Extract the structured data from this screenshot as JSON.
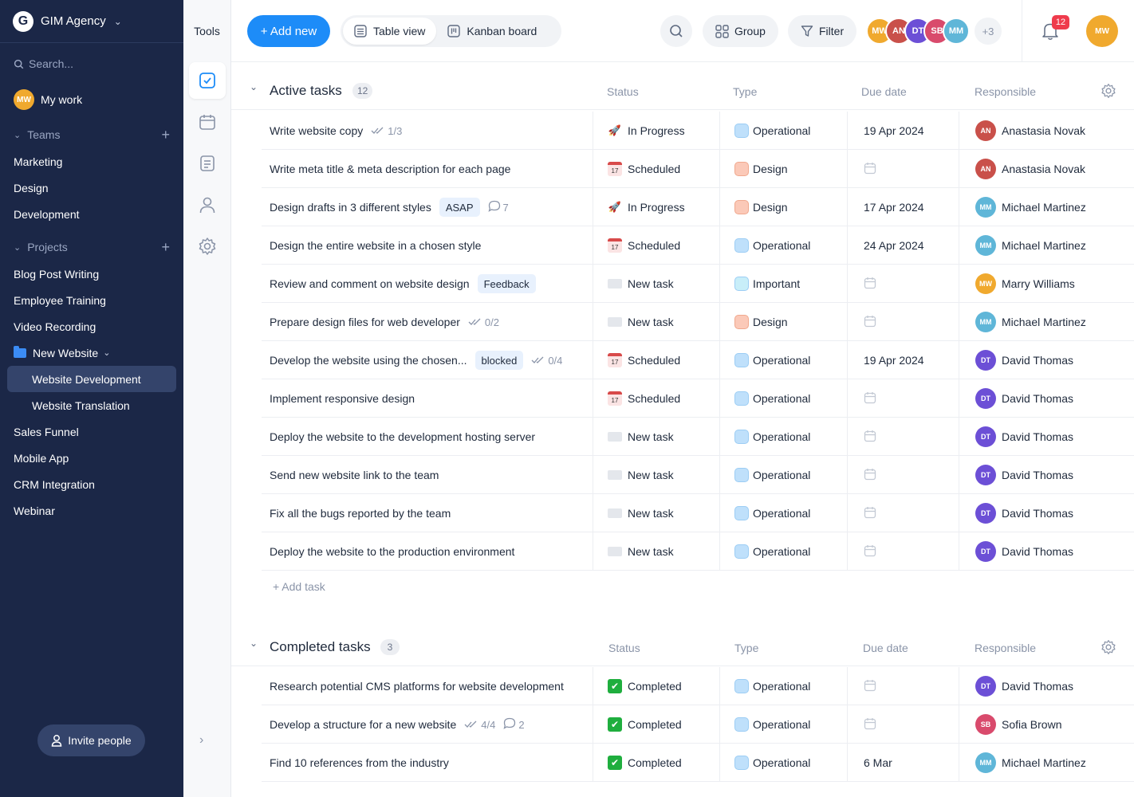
{
  "sidebar": {
    "workspace_name": "GIM Agency",
    "workspace_logo": "G",
    "search_placeholder": "Search...",
    "my_work_label": "My work",
    "teams_label": "Teams",
    "teams": [
      "Marketing",
      "Design",
      "Development"
    ],
    "projects_label": "Projects",
    "projects_top": [
      "Blog Post Writing",
      "Employee Training",
      "Video Recording"
    ],
    "folder_label": "New Website",
    "folder_items": [
      {
        "label": "Website Development",
        "active": true
      },
      {
        "label": "Website Translation",
        "active": false
      }
    ],
    "projects_bottom": [
      "Sales Funnel",
      "Mobile App",
      "CRM Integration",
      "Webinar"
    ],
    "invite_label": "Invite people"
  },
  "tools": {
    "title": "Tools",
    "icons": [
      "tasks-icon",
      "calendar-icon",
      "notes-icon",
      "people-icon",
      "settings-icon"
    ]
  },
  "toolbar": {
    "add_label": "+ Add new",
    "views": [
      {
        "label": "Table view",
        "active": true
      },
      {
        "label": "Kanban board",
        "active": false
      }
    ],
    "group_label": "Group",
    "filter_label": "Filter",
    "members_more": "+3",
    "notifications_count": "12"
  },
  "colors": {
    "sidebar_bg": "#1b2747",
    "accent": "#1d8cf8",
    "operational": "#bfe0fb",
    "design": "#fbc9b8",
    "important": "#c8eef9",
    "badge": "#ef3b4c"
  },
  "columns": {
    "status": "Status",
    "type": "Type",
    "due": "Due date",
    "responsible": "Responsible"
  },
  "active_group": {
    "title": "Active tasks",
    "count": "12",
    "add_task": "+ Add task",
    "rows": [
      {
        "name": "Write website copy",
        "tag": "",
        "checklist": "1/3",
        "comments": "",
        "status": "In Progress",
        "status_kind": "progress",
        "type": "Operational",
        "type_kind": "operational",
        "due": "19 Apr 2024",
        "resp": "Anastasia Novak",
        "resp_initials": "AN",
        "resp_color": "#c9504a"
      },
      {
        "name": "Write meta title & meta description for each page",
        "tag": "",
        "checklist": "",
        "comments": "",
        "status": "Scheduled",
        "status_kind": "scheduled",
        "type": "Design",
        "type_kind": "design",
        "due": "",
        "resp": "Anastasia Novak",
        "resp_initials": "AN",
        "resp_color": "#c9504a"
      },
      {
        "name": "Design drafts in 3 different styles",
        "tag": "ASAP",
        "checklist": "",
        "comments": "7",
        "status": "In Progress",
        "status_kind": "progress",
        "type": "Design",
        "type_kind": "design",
        "due": "17 Apr 2024",
        "resp": "Michael Martinez",
        "resp_initials": "MM",
        "resp_color": "#5fb6d8"
      },
      {
        "name": "Design the entire website in a chosen style",
        "tag": "",
        "checklist": "",
        "comments": "",
        "status": "Scheduled",
        "status_kind": "scheduled",
        "type": "Operational",
        "type_kind": "operational",
        "due": "24 Apr 2024",
        "resp": "Michael Martinez",
        "resp_initials": "MM",
        "resp_color": "#5fb6d8"
      },
      {
        "name": "Review and comment on website design",
        "tag": "Feedback",
        "checklist": "",
        "comments": "",
        "status": "New task",
        "status_kind": "new",
        "type": "Important",
        "type_kind": "important",
        "due": "",
        "resp": "Marry Williams",
        "resp_initials": "MW",
        "resp_color": "#f0a92e"
      },
      {
        "name": "Prepare design files for web developer",
        "tag": "",
        "checklist": "0/2",
        "comments": "",
        "status": "New task",
        "status_kind": "new",
        "type": "Design",
        "type_kind": "design",
        "due": "",
        "resp": "Michael Martinez",
        "resp_initials": "MM",
        "resp_color": "#5fb6d8"
      },
      {
        "name": "Develop the website using the chosen...",
        "tag": "blocked",
        "checklist": "0/4",
        "comments": "",
        "status": "Scheduled",
        "status_kind": "scheduled",
        "type": "Operational",
        "type_kind": "operational",
        "due": "19 Apr 2024",
        "resp": "David Thomas",
        "resp_initials": "DT",
        "resp_color": "#6c4fd6"
      },
      {
        "name": "Implement responsive design",
        "tag": "",
        "checklist": "",
        "comments": "",
        "status": "Scheduled",
        "status_kind": "scheduled",
        "type": "Operational",
        "type_kind": "operational",
        "due": "",
        "resp": "David Thomas",
        "resp_initials": "DT",
        "resp_color": "#6c4fd6"
      },
      {
        "name": "Deploy the website to the development hosting server",
        "tag": "",
        "checklist": "",
        "comments": "",
        "status": "New task",
        "status_kind": "new",
        "type": "Operational",
        "type_kind": "operational",
        "due": "",
        "resp": "David Thomas",
        "resp_initials": "DT",
        "resp_color": "#6c4fd6"
      },
      {
        "name": "Send new website link to the team",
        "tag": "",
        "checklist": "",
        "comments": "",
        "status": "New task",
        "status_kind": "new",
        "type": "Operational",
        "type_kind": "operational",
        "due": "",
        "resp": "David Thomas",
        "resp_initials": "DT",
        "resp_color": "#6c4fd6"
      },
      {
        "name": "Fix all the bugs reported by the team",
        "tag": "",
        "checklist": "",
        "comments": "",
        "status": "New task",
        "status_kind": "new",
        "type": "Operational",
        "type_kind": "operational",
        "due": "",
        "resp": "David Thomas",
        "resp_initials": "DT",
        "resp_color": "#6c4fd6"
      },
      {
        "name": "Deploy the website to the production environment",
        "tag": "",
        "checklist": "",
        "comments": "",
        "status": "New task",
        "status_kind": "new",
        "type": "Operational",
        "type_kind": "operational",
        "due": "",
        "resp": "David Thomas",
        "resp_initials": "DT",
        "resp_color": "#6c4fd6"
      }
    ]
  },
  "completed_group": {
    "title": "Completed tasks",
    "count": "3",
    "rows": [
      {
        "name": "Research potential CMS platforms for website development",
        "tag": "",
        "checklist": "",
        "comments": "",
        "status": "Completed",
        "status_kind": "done",
        "type": "Operational",
        "type_kind": "operational",
        "due": "",
        "resp": "David Thomas",
        "resp_initials": "DT",
        "resp_color": "#6c4fd6"
      },
      {
        "name": "Develop a structure for a new website",
        "tag": "",
        "checklist": "4/4",
        "comments": "2",
        "status": "Completed",
        "status_kind": "done",
        "type": "Operational",
        "type_kind": "operational",
        "due": "",
        "resp": "Sofia Brown",
        "resp_initials": "SB",
        "resp_color": "#d94a6c"
      },
      {
        "name": "Find 10 references from the industry",
        "tag": "",
        "checklist": "",
        "comments": "",
        "status": "Completed",
        "status_kind": "done",
        "type": "Operational",
        "type_kind": "operational",
        "due": "6 Mar",
        "resp": "Michael Martinez",
        "resp_initials": "MM",
        "resp_color": "#5fb6d8"
      }
    ]
  }
}
